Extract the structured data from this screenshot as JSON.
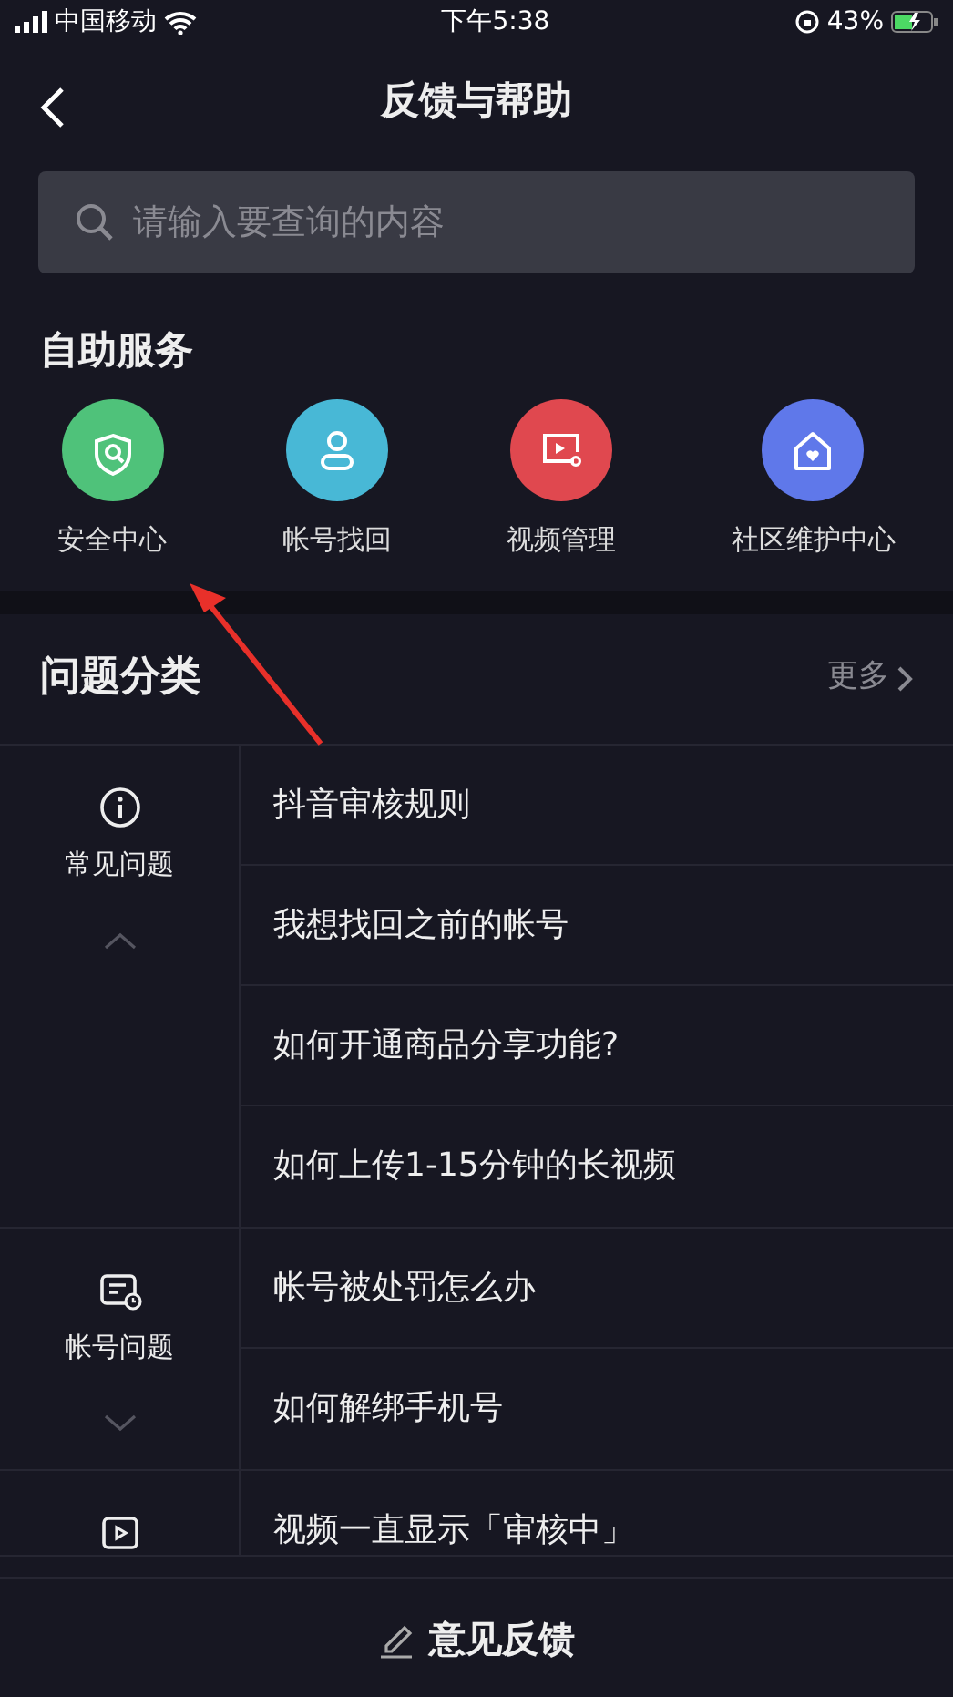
{
  "status_bar": {
    "carrier": "中国移动",
    "time": "下午5:38",
    "battery": "43%"
  },
  "header": {
    "title": "反馈与帮助"
  },
  "search": {
    "placeholder": "请输入要查询的内容"
  },
  "self_service": {
    "title": "自助服务",
    "items": [
      {
        "label": "安全中心",
        "kind": "shield",
        "color": "#4fc27a"
      },
      {
        "label": "帐号找回",
        "kind": "person",
        "color": "#48b8d6"
      },
      {
        "label": "视频管理",
        "kind": "video",
        "color": "#e0484f"
      },
      {
        "label": "社区维护中心",
        "kind": "house",
        "color": "#5f78ea"
      }
    ]
  },
  "categories": {
    "title": "问题分类",
    "more": "更多",
    "groups": [
      {
        "kind": "info",
        "label": "常见问题",
        "expanded": true,
        "questions": [
          "抖音审核规则",
          "我想找回之前的帐号",
          "如何开通商品分享功能?",
          "如何上传1-15分钟的长视频"
        ]
      },
      {
        "kind": "account",
        "label": "帐号问题",
        "expanded": false,
        "questions": [
          "帐号被处罚怎么办",
          "如何解绑手机号"
        ]
      },
      {
        "kind": "video",
        "questions": [
          "视频一直显示「审核中」"
        ]
      }
    ]
  },
  "footer": {
    "button": "意见反馈"
  }
}
